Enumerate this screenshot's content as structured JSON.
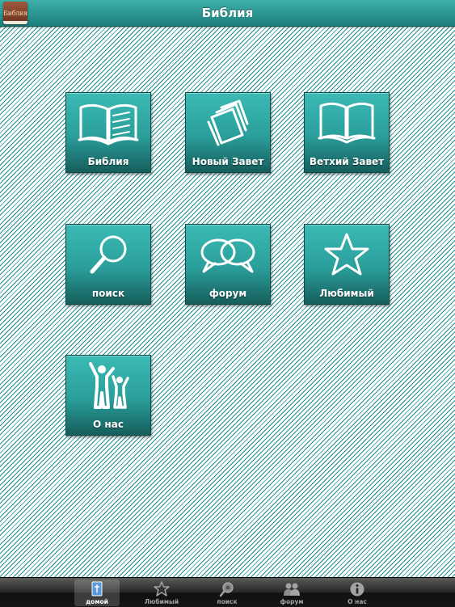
{
  "header": {
    "app_icon_text": "Библия",
    "title": "Библия"
  },
  "tiles": [
    {
      "label": "Библия",
      "icon": "open-book-icon"
    },
    {
      "label": "Новый Завет",
      "icon": "scroll-pages-icon"
    },
    {
      "label": "Ветхий Завет",
      "icon": "open-book-outline-icon"
    },
    {
      "label": "поиск",
      "icon": "magnifier-icon"
    },
    {
      "label": "форум",
      "icon": "speech-bubbles-icon"
    },
    {
      "label": "Любимый",
      "icon": "star-icon"
    },
    {
      "label": "О нас",
      "icon": "people-icon"
    }
  ],
  "tabbar": {
    "tabs": [
      {
        "label": "домой",
        "icon": "home-book-icon",
        "active": true
      },
      {
        "label": "Любимый",
        "icon": "star-icon",
        "active": false
      },
      {
        "label": "поиск",
        "icon": "search-icon",
        "active": false
      },
      {
        "label": "форум",
        "icon": "users-icon",
        "active": false
      },
      {
        "label": "О нас",
        "icon": "info-icon",
        "active": false
      }
    ]
  },
  "colors": {
    "accent": "#2a9e9a",
    "tile_dark": "#165e5c",
    "tabbar": "#1a1a1a"
  }
}
